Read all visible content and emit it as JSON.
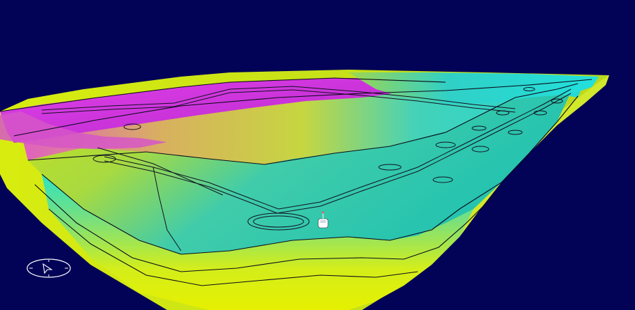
{
  "viewport": {
    "background": "#020257",
    "colormap": [
      "#e0f200",
      "#c8e020",
      "#2ec8a8",
      "#22d6d0",
      "#e23ce6"
    ]
  },
  "model": {
    "outline_color": "#0a0a1a",
    "road_color": "#101020"
  },
  "vehicle": {
    "icon": "car-marker-icon",
    "color": "#ffffff"
  },
  "compass": {
    "icon": "north-arrow-icon",
    "color": "#ffffff",
    "label": ""
  }
}
